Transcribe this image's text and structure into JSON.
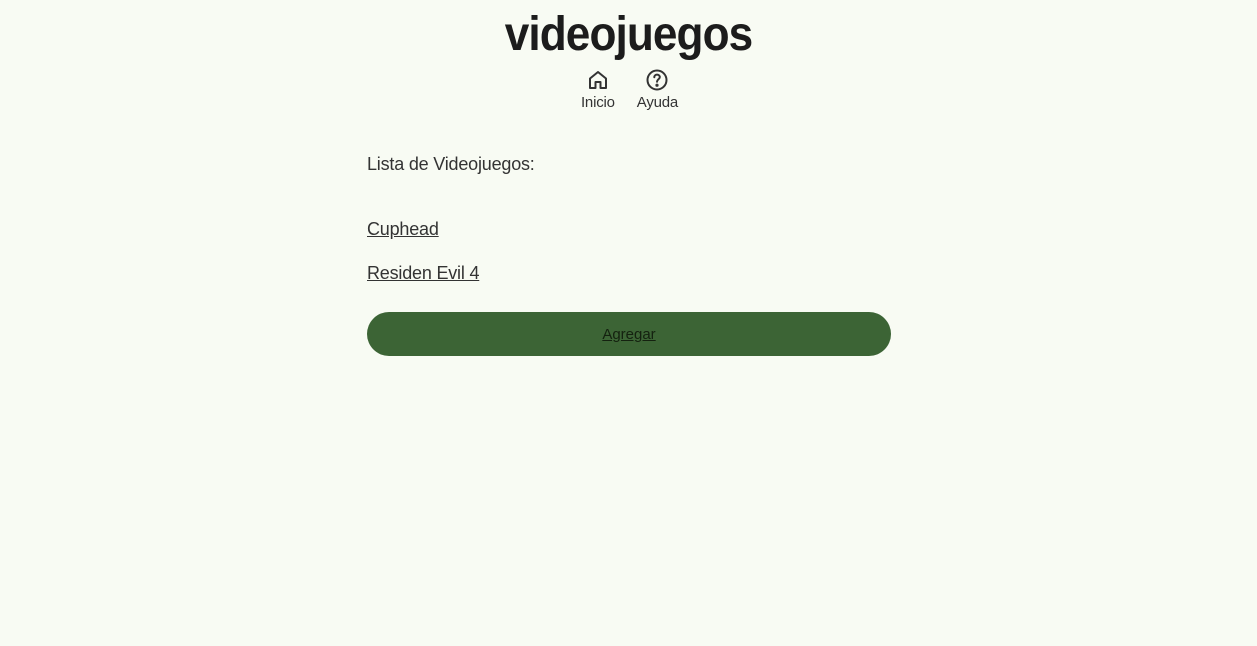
{
  "header": {
    "title": "videojuegos"
  },
  "nav": {
    "items": [
      {
        "label": "Inicio",
        "icon": "home-icon"
      },
      {
        "label": "Ayuda",
        "icon": "help-icon"
      }
    ]
  },
  "main": {
    "list_title": "Lista de Videojuegos:",
    "games": [
      "Cuphead",
      "Residen Evil 4"
    ],
    "add_button_label": "Agregar"
  },
  "colors": {
    "background": "#f8fbf3",
    "button": "#3c6435",
    "text": "#333333"
  }
}
